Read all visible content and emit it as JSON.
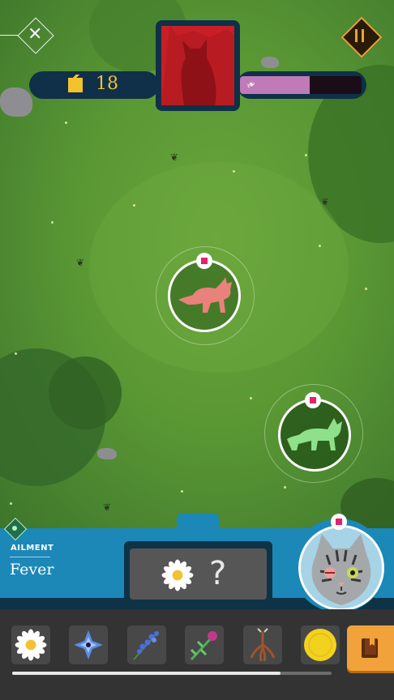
{
  "hud": {
    "score": "18",
    "progress_fraction": 0.57,
    "close_icon": "close-icon",
    "pause_icon": "pause-icon",
    "coin_icon": "cat-coin-icon",
    "feather_icon": "feather-icon"
  },
  "cats": [
    {
      "color": "#e8827a",
      "icon": "pink-cat-icon"
    },
    {
      "color": "#8fe08a",
      "icon": "green-cat-icon"
    }
  ],
  "ailment": {
    "label": "AILMENT",
    "name": "Fever",
    "diagnosis_unknown": "?",
    "herb_icon": "daisy-icon",
    "patient_icon": "tabby-cat-portrait"
  },
  "herbs": [
    {
      "name": "daisy-icon"
    },
    {
      "name": "blue-star-flower-icon"
    },
    {
      "name": "lavender-icon"
    },
    {
      "name": "thistle-icon"
    },
    {
      "name": "root-icon"
    },
    {
      "name": "golden-coin-icon"
    }
  ],
  "tray": {
    "scroll_fraction": 0.84,
    "book_icon": "book-icon"
  },
  "colors": {
    "grass": "#5a9834",
    "panel": "#1b88b8",
    "panel_dark": "#0e3346",
    "accent_gold": "#f2c230",
    "progress": "#c07ab8",
    "portrait_red": "#c81f26",
    "book_orange": "#f2a23a"
  }
}
